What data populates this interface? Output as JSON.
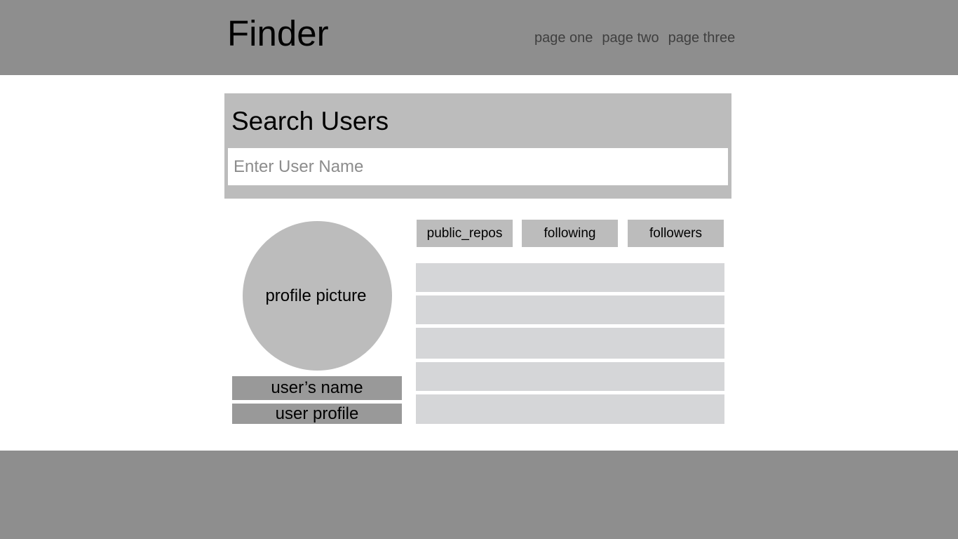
{
  "header": {
    "brand": "Finder",
    "nav": [
      "page one",
      "page two",
      "page three"
    ]
  },
  "search": {
    "title": "Search Users",
    "placeholder": "Enter User Name",
    "value": ""
  },
  "profile": {
    "picture_label": "profile picture",
    "name_label": "user’s name",
    "profile_label": "user profile"
  },
  "stats": {
    "buttons": [
      "public_repos",
      "following",
      "followers"
    ]
  },
  "results": {
    "row_count_visible": 5
  },
  "colors": {
    "header_bg": "#8e8e8e",
    "panel_bg": "#bcbcbc",
    "row_bg": "#d5d6d8",
    "name_bar_bg": "#999999"
  }
}
